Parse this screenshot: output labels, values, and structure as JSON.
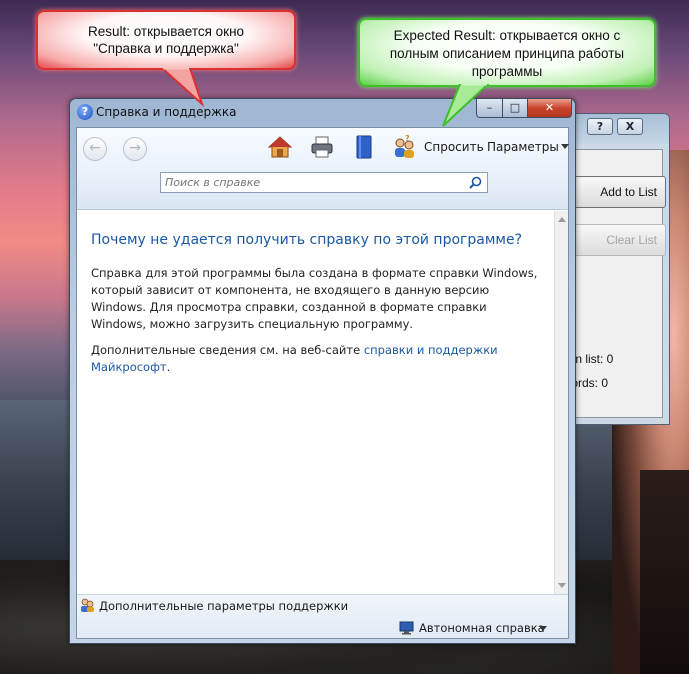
{
  "background_window": {
    "controls": [
      "?",
      "X"
    ],
    "add_button": "Add to List",
    "clear_button": "Clear List",
    "items_in_list": "Items in list: 0",
    "records": "Records: 0"
  },
  "help_window": {
    "title": "Справка и поддержка",
    "help_icon": "question-circle-icon",
    "controls": {
      "minimize": "–",
      "maximize": "□",
      "close": "✕"
    },
    "toolbar": {
      "back_icon": "back-arrow-icon",
      "forward_icon": "forward-arrow-icon",
      "home_icon": "home-icon",
      "print_icon": "printer-icon",
      "browse_icon": "book-icon",
      "ask_icon": "ask-people-icon",
      "ask_label": "Спросить",
      "options_label": "Параметры"
    },
    "search": {
      "placeholder": "Поиск в справке",
      "icon": "search-icon"
    },
    "content": {
      "heading": "Почему не удается получить справку по этой программе?",
      "paragraph1": "Справка для этой программы была создана в формате справки Windows, который зависит от компонента, не входящего в данную версию Windows. Для просмотра справки, созданной в формате справки Windows, можно загрузить специальную программу.",
      "paragraph2_prefix": "Дополнительные сведения см. на веб-сайте ",
      "paragraph2_link": "справки и поддержки Майкрософт",
      "paragraph2_suffix": "."
    },
    "footer": {
      "support_link": "Дополнительные параметры поддержки",
      "mode_label": "Автономная справка"
    }
  },
  "annotations": {
    "result": "Result: открывается окно \"Справка и поддержка\"",
    "result_line1": "Result: открывается окно",
    "result_line2": "\"Справка и поддержка\"",
    "expected_line1": "Expected Result: открывается окно с",
    "expected_line2": "полным описанием принципа работы",
    "expected_line3": "программы",
    "colors": {
      "result": "#e24a4a",
      "expected": "#5bd046"
    }
  }
}
